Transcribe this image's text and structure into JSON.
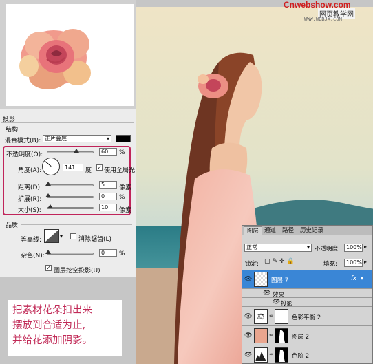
{
  "watermark": {
    "site": "Cnwebshow.com",
    "cn": "网页教学网",
    "url": "WWW.WEBJX.COM"
  },
  "caption": [
    "把素材花朵扣出来",
    "摆放到合适为止,",
    "并给花添加阴影。"
  ],
  "dialog": {
    "title": "投影",
    "section_structure": "结构",
    "blend_mode_label": "混合模式(B):",
    "blend_mode_value": "正片叠底",
    "opacity_label": "不透明度(O):",
    "opacity_value": "60",
    "opacity_unit": "%",
    "angle_label": "角度(A):",
    "angle_value": "141",
    "angle_unit": "度",
    "global_light_label": "使用全局光",
    "global_light_checked": true,
    "distance_label": "距离(D):",
    "distance_value": "5",
    "distance_unit": "像素",
    "spread_label": "扩展(R):",
    "spread_value": "0",
    "spread_unit": "%",
    "size_label": "大小(S):",
    "size_value": "10",
    "size_unit": "像素",
    "section_quality": "品质",
    "contour_label": "等高线:",
    "antialias_label": "消除锯齿(L)",
    "antialias_checked": false,
    "noise_label": "杂色(N):",
    "noise_value": "0",
    "noise_unit": "%",
    "knockout_label": "图层挖空投影(U)",
    "knockout_checked": true
  },
  "layers_panel": {
    "tabs": [
      "图层",
      "通道",
      "路径",
      "历史记录"
    ],
    "active_tab": 0,
    "blend_mode": "正常",
    "opacity_label": "不透明度:",
    "opacity_value": "100%",
    "lock_label": "锁定:",
    "fill_label": "填充:",
    "fill_value": "100%",
    "layers": [
      {
        "name": "图层 7",
        "fx": "fx",
        "selected": true
      },
      {
        "name": "效果",
        "sub": true
      },
      {
        "name": "投影",
        "sub": true
      },
      {
        "name": "色彩平衡 2"
      },
      {
        "name": "图层 2"
      },
      {
        "name": "色阶 2"
      }
    ]
  },
  "colors": {
    "caption_text": "#c12a57",
    "red_box": "#c0245a",
    "selected_layer": "#3a86d6",
    "watermark_red": "#d01e1e"
  }
}
